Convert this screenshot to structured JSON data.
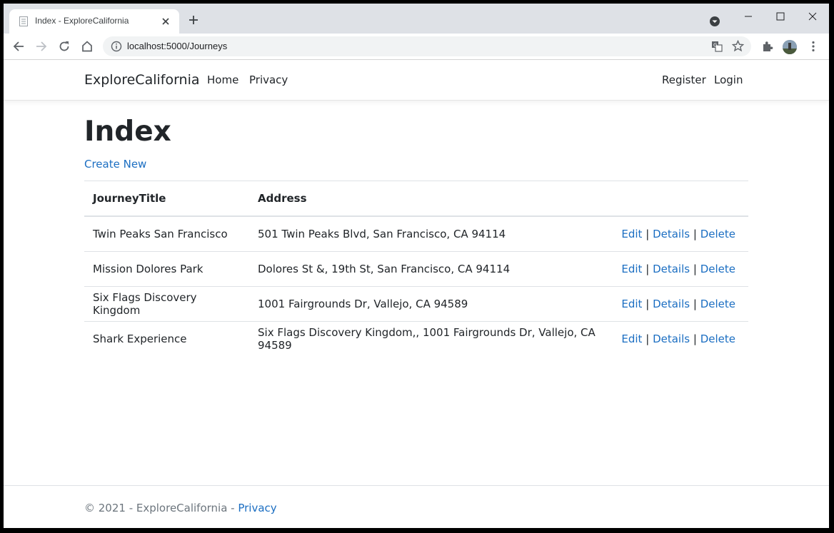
{
  "browser": {
    "tab_title": "Index - ExploreCalifornia",
    "url": "localhost:5000/Journeys"
  },
  "navbar": {
    "brand": "ExploreCalifornia",
    "home": "Home",
    "privacy": "Privacy",
    "register": "Register",
    "login": "Login"
  },
  "main": {
    "heading": "Index",
    "create_new": "Create New",
    "table": {
      "headers": {
        "title": "JourneyTitle",
        "address": "Address"
      },
      "rows": [
        {
          "title": "Twin Peaks San Francisco",
          "address": "501 Twin Peaks Blvd, San Francisco, CA 94114"
        },
        {
          "title": "Mission Dolores Park",
          "address": "Dolores St &, 19th St, San Francisco, CA 94114"
        },
        {
          "title": "Six Flags Discovery Kingdom",
          "address": "1001 Fairgrounds Dr, Vallejo, CA 94589"
        },
        {
          "title": "Shark Experience",
          "address": "Six Flags Discovery Kingdom,, 1001 Fairgrounds Dr, Vallejo, CA 94589"
        }
      ],
      "actions": {
        "edit": "Edit",
        "details": "Details",
        "delete": "Delete",
        "separator": "|"
      }
    }
  },
  "footer": {
    "text": "© 2021 - ExploreCalifornia - ",
    "privacy": "Privacy"
  },
  "colors": {
    "link": "#1b6ec2",
    "text": "#212529",
    "muted": "#6c757d"
  }
}
